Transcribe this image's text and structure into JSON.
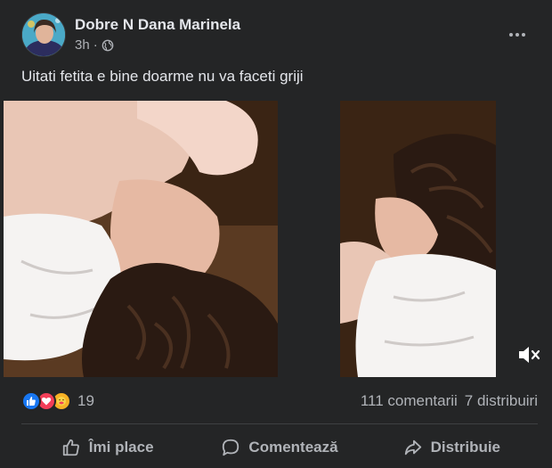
{
  "post": {
    "author": "Dobre N Dana Marinela",
    "time": "3h",
    "separator": "·",
    "caption": "Uitati fetita e bine doarme nu va faceti griji"
  },
  "icons": {
    "avatar": "avatar-photo",
    "audience": "globe-icon",
    "more": "more-options-icon",
    "mute": "speaker-muted-icon",
    "like": "thumbs-up-icon",
    "comment": "comment-bubble-icon",
    "share": "share-arrow-icon"
  },
  "stats": {
    "reaction_count": "19",
    "comments": "111 comentarii",
    "shares": "7 distribuiri"
  },
  "actions": {
    "like": "Îmi place",
    "comment": "Comentează",
    "share": "Distribuie"
  },
  "colors": {
    "background": "#242526",
    "text_primary": "#e4e6eb",
    "text_secondary": "#b0b3b8",
    "like_blue": "#1877f2",
    "love_red": "#f33e58",
    "care_yellow": "#f7b125"
  }
}
